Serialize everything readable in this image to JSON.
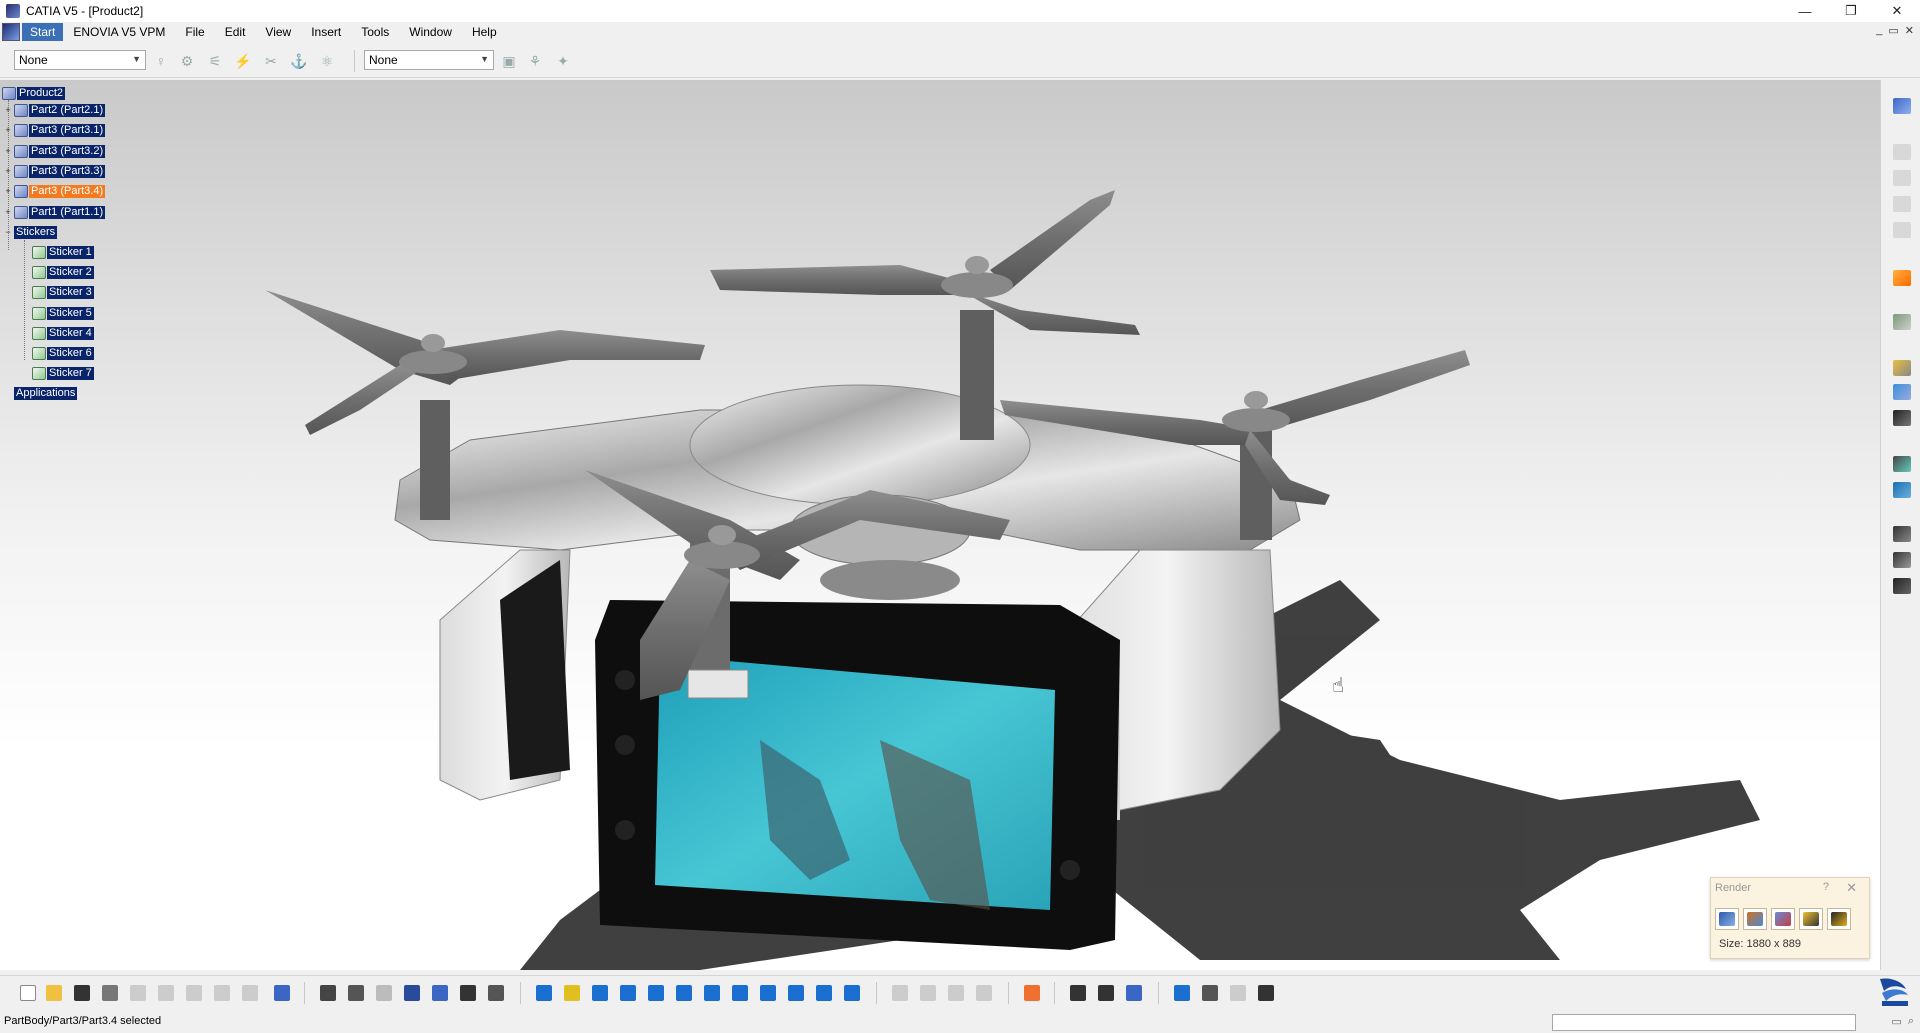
{
  "window": {
    "title": "CATIA V5 - [Product2]",
    "controls": [
      "—",
      "❐",
      "✕"
    ]
  },
  "menu": {
    "start": "Start",
    "items": [
      "ENOVIA V5 VPM",
      "File",
      "Edit",
      "View",
      "Insert",
      "Tools",
      "Window",
      "Help"
    ],
    "doc_controls": [
      "_",
      "▭",
      "✕"
    ]
  },
  "toolbar_top": {
    "select1": "None",
    "select2": "None"
  },
  "tree": {
    "root": "Product2",
    "parts": [
      {
        "label": "Part2 (Part2.1)",
        "highlight": false
      },
      {
        "label": "Part3 (Part3.1)",
        "highlight": false
      },
      {
        "label": "Part3 (Part3.2)",
        "highlight": false
      },
      {
        "label": "Part3 (Part3.3)",
        "highlight": false
      },
      {
        "label": "Part3 (Part3.4)",
        "highlight": true
      },
      {
        "label": "Part1 (Part1.1)",
        "highlight": false
      }
    ],
    "stickers_label": "Stickers",
    "stickers": [
      "Sticker 1",
      "Sticker 2",
      "Sticker 3",
      "Sticker 5",
      "Sticker 4",
      "Sticker 6",
      "Sticker 7"
    ],
    "applications": "Applications"
  },
  "render_dialog": {
    "title": "Render",
    "help": "?",
    "close": "✕",
    "size_text": "Size: 1880 x 889"
  },
  "status": {
    "text": "PartBody/Part3/Part3.4 selected"
  },
  "colors": {
    "selection_blue": "#0a246a",
    "highlight_orange": "#f47a20",
    "screen_teal": "#36b4c4"
  }
}
